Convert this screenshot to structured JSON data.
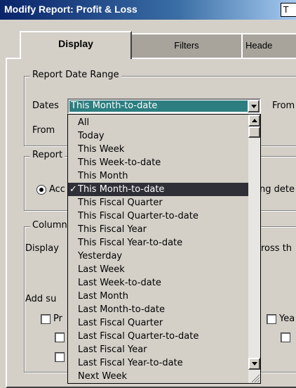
{
  "window": {
    "title": "Modify Report: Profit & Loss",
    "title_box": "T"
  },
  "tabs": [
    {
      "label": "Display",
      "active": true
    },
    {
      "label": "Filters",
      "active": false
    },
    {
      "label": "Heade",
      "active": false
    }
  ],
  "date_range": {
    "legend": "Report Date Range",
    "dates_label": "Dates",
    "selected": "This Month-to-date",
    "from_right": "From",
    "from_label": "From"
  },
  "basis": {
    "legend": "Report",
    "radio_label": "Acc",
    "right_text": "ng dete"
  },
  "columns": {
    "legend": "Column",
    "display_label": "Display",
    "right_text": "ross th",
    "add_label": "Add su",
    "pr_label": "Pr",
    "ye_label": "Yea"
  },
  "dropdown": {
    "items": [
      "All",
      "Today",
      "This Week",
      "This Week-to-date",
      "This Month",
      "This Month-to-date",
      "This Fiscal Quarter",
      "This Fiscal Quarter-to-date",
      "This Fiscal Year",
      "This Fiscal Year-to-date",
      "Yesterday",
      "Last Week",
      "Last Week-to-date",
      "Last Month",
      "Last Month-to-date",
      "Last Fiscal Quarter",
      "Last Fiscal Quarter-to-date",
      "Last Fiscal Year",
      "Last Fiscal Year-to-date",
      "Next Week"
    ],
    "selected_index": 5,
    "check_glyph": "✓"
  },
  "colors": {
    "title_bar": "#0a246a",
    "selection": "#2c7e80",
    "highlight": "#2f2f38"
  }
}
